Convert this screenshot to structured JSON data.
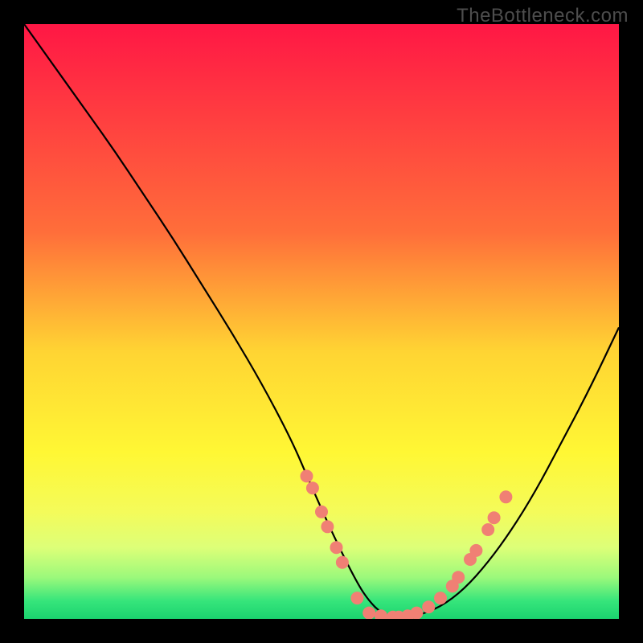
{
  "watermark": "TheBottleneck.com",
  "chart_data": {
    "type": "line",
    "title": "",
    "xlabel": "",
    "ylabel": "",
    "xlim": [
      0,
      100
    ],
    "ylim": [
      0,
      100
    ],
    "background_gradient": {
      "stops": [
        {
          "offset": 0,
          "color": "#ff1745"
        },
        {
          "offset": 35,
          "color": "#ff6e3a"
        },
        {
          "offset": 55,
          "color": "#ffd433"
        },
        {
          "offset": 72,
          "color": "#fff734"
        },
        {
          "offset": 82,
          "color": "#f4fb5a"
        },
        {
          "offset": 88,
          "color": "#ddff78"
        },
        {
          "offset": 93,
          "color": "#9cf97b"
        },
        {
          "offset": 97,
          "color": "#36e57b"
        },
        {
          "offset": 100,
          "color": "#1bd36f"
        }
      ]
    },
    "series": [
      {
        "name": "bottleneck-curve",
        "color": "#000000",
        "x": [
          0,
          5,
          10,
          15,
          20,
          25,
          30,
          35,
          40,
          45,
          48,
          52,
          56,
          58,
          60,
          63,
          66,
          70,
          74,
          78,
          82,
          86,
          90,
          95,
          100
        ],
        "y": [
          100,
          93,
          86,
          79,
          71.5,
          64,
          56,
          48,
          39.5,
          30,
          23,
          14,
          6,
          3,
          1,
          0,
          0.5,
          2,
          5,
          9.5,
          15,
          21.5,
          29,
          38.5,
          49
        ]
      }
    ],
    "markers": {
      "name": "highlight-dots",
      "color": "#f08074",
      "radius_px": 8,
      "points": [
        {
          "x": 47.5,
          "y": 24
        },
        {
          "x": 48.5,
          "y": 22
        },
        {
          "x": 50,
          "y": 18
        },
        {
          "x": 51,
          "y": 15.5
        },
        {
          "x": 52.5,
          "y": 12
        },
        {
          "x": 53.5,
          "y": 9.5
        },
        {
          "x": 56,
          "y": 3.5
        },
        {
          "x": 58,
          "y": 1
        },
        {
          "x": 60,
          "y": 0.5
        },
        {
          "x": 62,
          "y": 0.3
        },
        {
          "x": 63,
          "y": 0.3
        },
        {
          "x": 64.5,
          "y": 0.5
        },
        {
          "x": 66,
          "y": 1
        },
        {
          "x": 68,
          "y": 2
        },
        {
          "x": 70,
          "y": 3.5
        },
        {
          "x": 72,
          "y": 5.5
        },
        {
          "x": 73,
          "y": 7
        },
        {
          "x": 75,
          "y": 10
        },
        {
          "x": 76,
          "y": 11.5
        },
        {
          "x": 78,
          "y": 15
        },
        {
          "x": 79,
          "y": 17
        },
        {
          "x": 81,
          "y": 20.5
        }
      ]
    }
  }
}
